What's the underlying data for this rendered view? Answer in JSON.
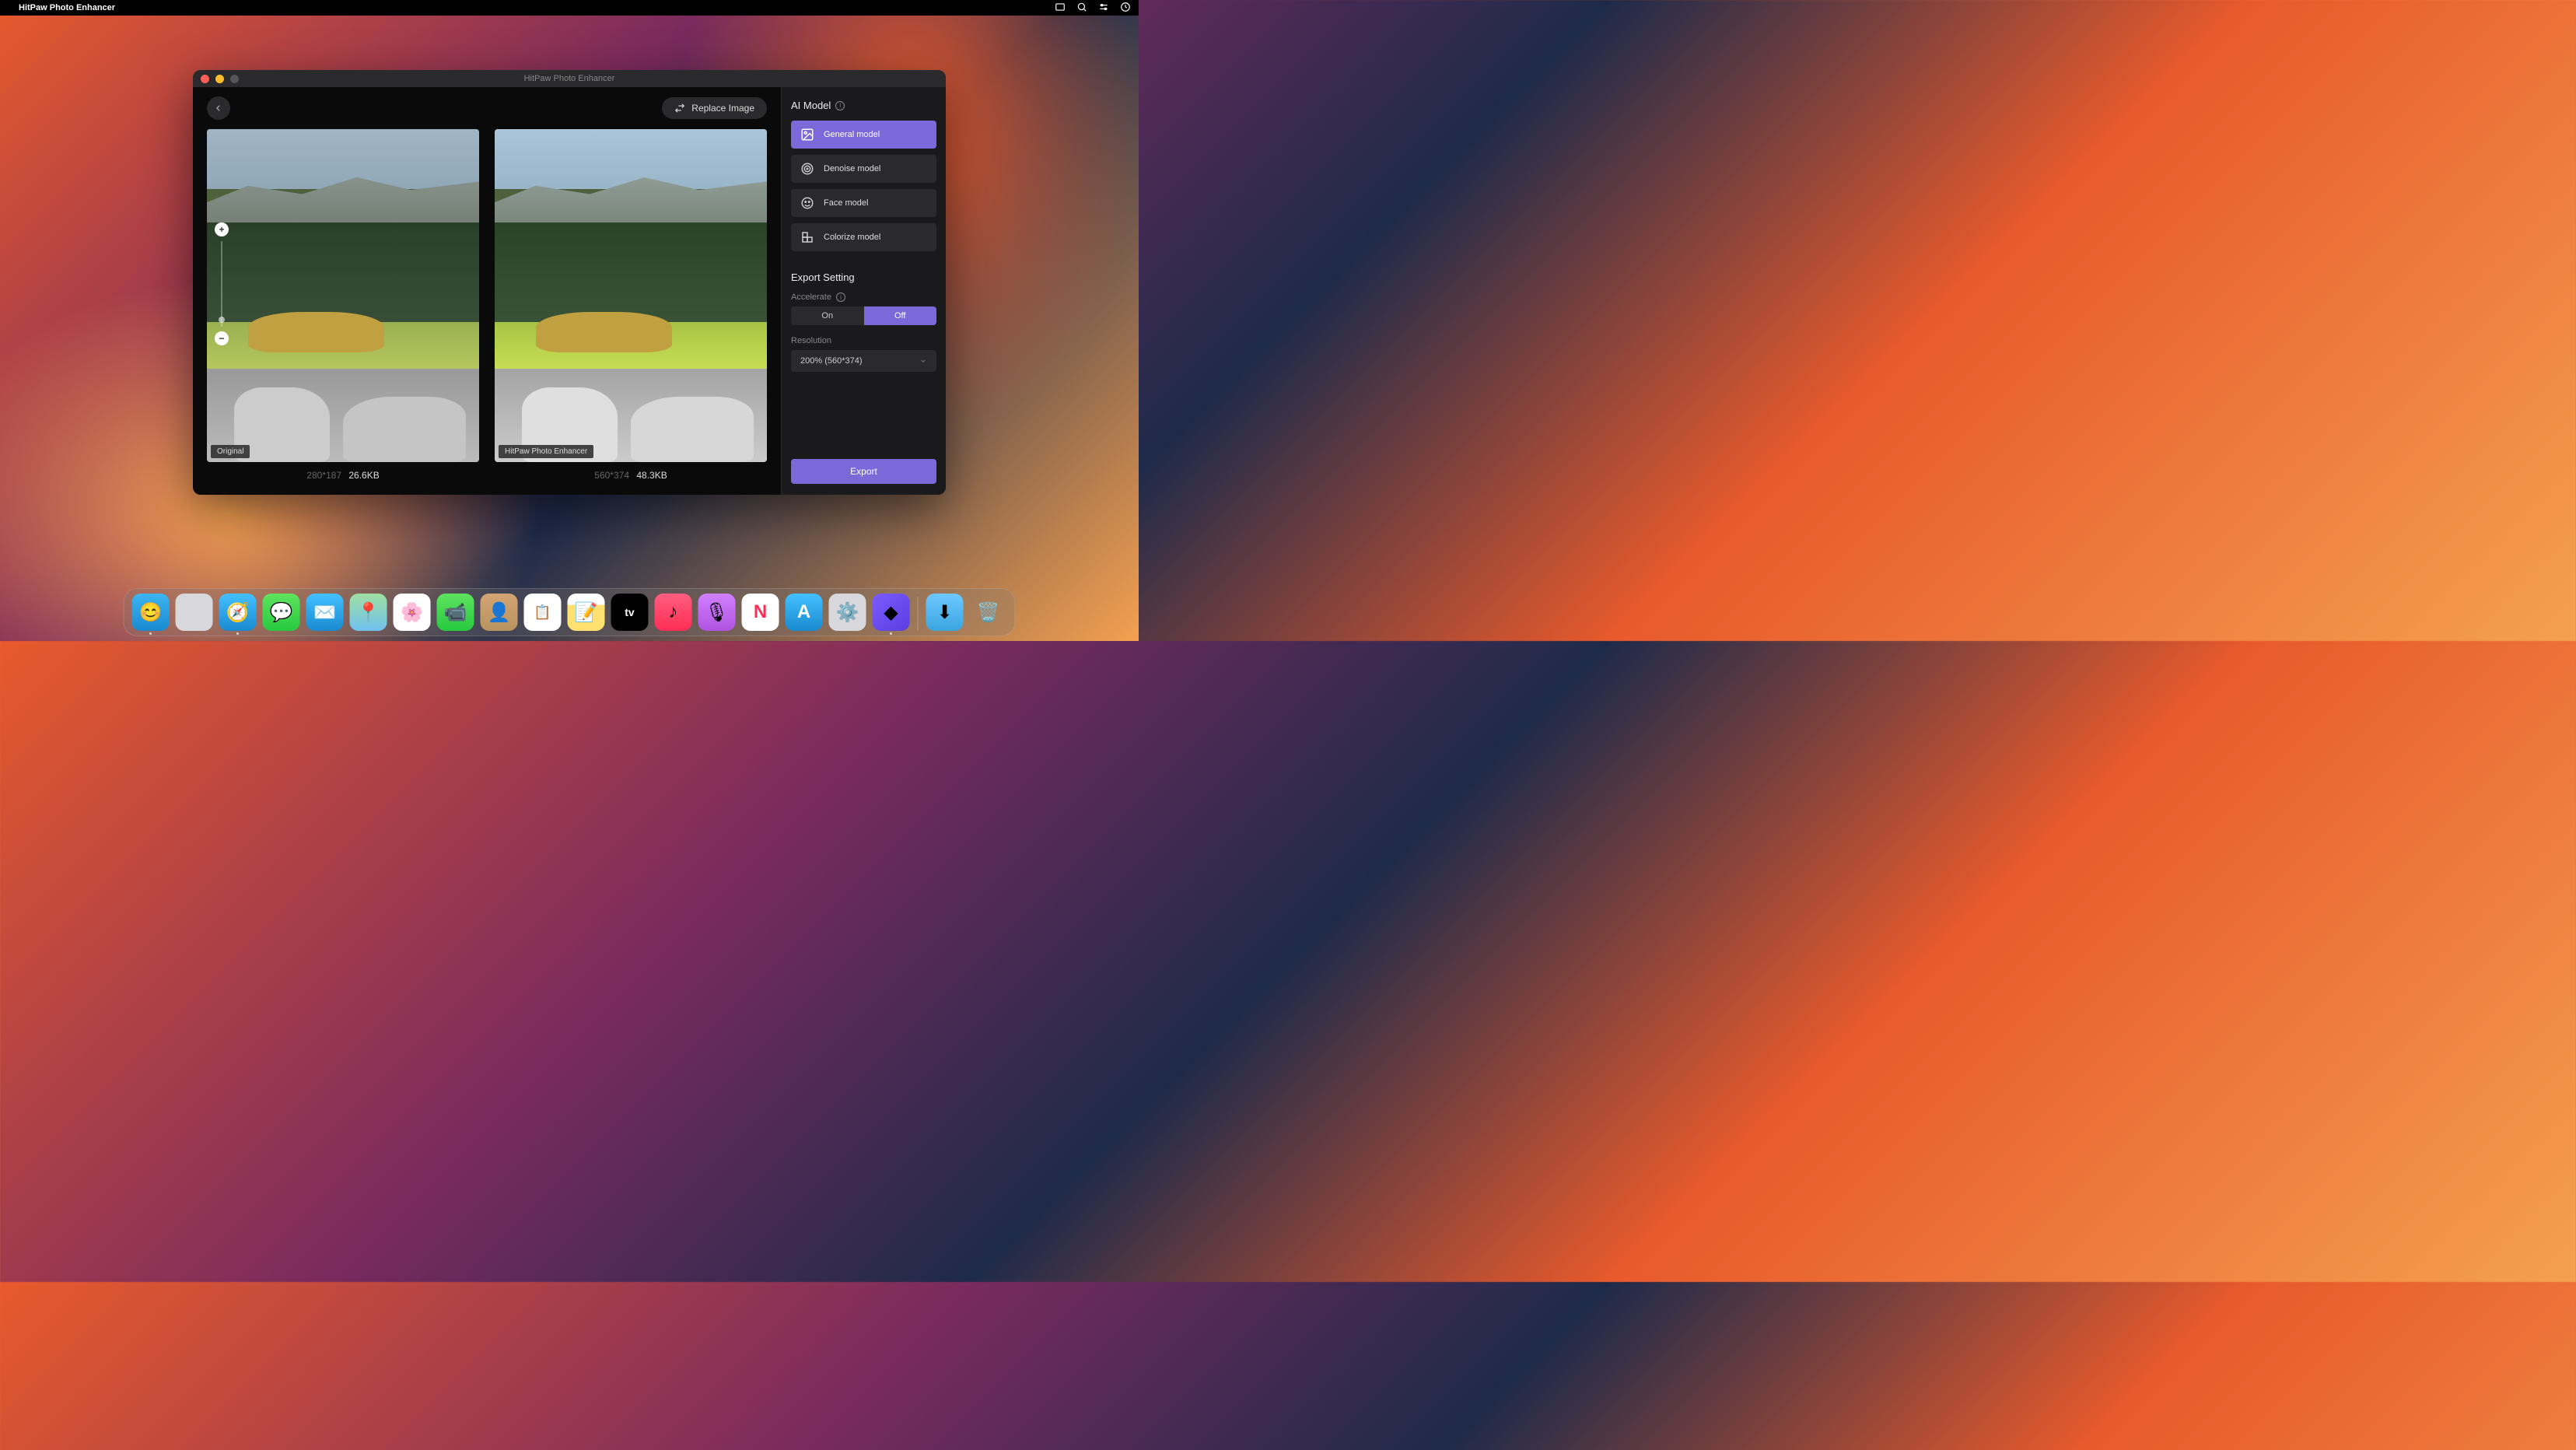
{
  "menubar": {
    "app_name": "HitPaw Photo Enhancer"
  },
  "window": {
    "title": "HitPaw Photo Enhancer",
    "toolbar": {
      "replace_label": "Replace Image"
    },
    "compare": {
      "original": {
        "badge": "Original",
        "dims": "280*187",
        "size": "26.6KB"
      },
      "enhanced": {
        "badge": "HitPaw Photo Enhancer",
        "dims": "560*374",
        "size": "48.3KB"
      }
    }
  },
  "sidebar": {
    "ai_model_heading": "AI Model",
    "models": [
      {
        "label": "General model",
        "selected": true
      },
      {
        "label": "Denoise model",
        "selected": false
      },
      {
        "label": "Face model",
        "selected": false
      },
      {
        "label": "Colorize model",
        "selected": false
      }
    ],
    "export_heading": "Export Setting",
    "accelerate_label": "Accelerate",
    "accelerate": {
      "on": "On",
      "off": "Off",
      "value": "Off"
    },
    "resolution_label": "Resolution",
    "resolution_value": "200% (560*374)",
    "export_button": "Export"
  },
  "dock": {
    "items": [
      "finder",
      "launchpad",
      "safari",
      "messages",
      "mail",
      "maps",
      "photos",
      "facetime",
      "contacts",
      "reminders",
      "notes",
      "appletv",
      "music",
      "podcasts",
      "news",
      "appstore",
      "settings",
      "hitpaw"
    ],
    "running": [
      "finder",
      "safari",
      "hitpaw"
    ]
  }
}
